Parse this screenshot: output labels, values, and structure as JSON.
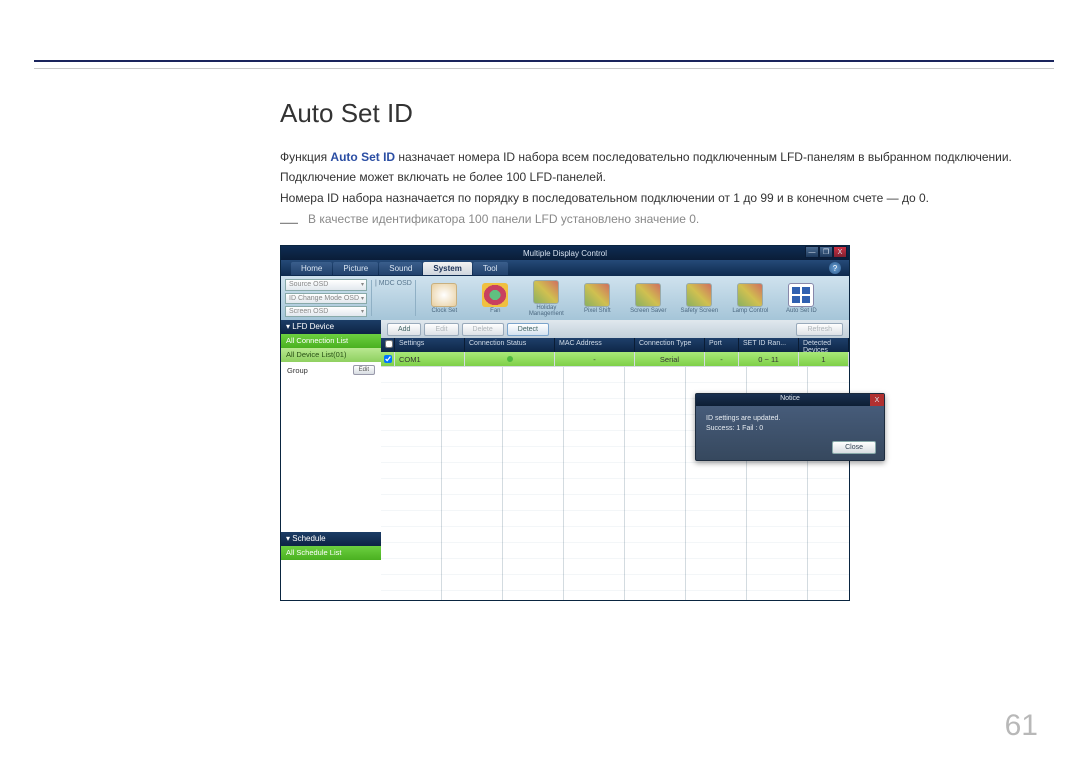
{
  "heading": "Auto Set ID",
  "p1_a": "Функция ",
  "p1_b": "Auto Set ID",
  "p1_c": " назначает номера ID набора всем последовательно подключенным LFD-панелям в выбранном подключении.",
  "p2": "Подключение может включать не более 100 LFD-панелей.",
  "p3": "Номера ID набора назначается по порядку в последовательном подключении от 1 до 99 и в конечном счете — до 0.",
  "note": "В качестве идентификатора 100 панели LFD установлено значение 0.",
  "page_number": "61",
  "app": {
    "title": "Multiple Display Control",
    "min": "—",
    "max": "❐",
    "close": "X",
    "tabs": {
      "home": "Home",
      "picture": "Picture",
      "sound": "Sound",
      "system": "System",
      "tool": "Tool"
    },
    "help": "?",
    "dd1": "Source OSD",
    "dd2": "ID Change Mode OSD",
    "dd3": "Screen OSD",
    "dd_sep": "| MDC OSD",
    "ricons": {
      "clock": "Clock Set",
      "fan": "Fan",
      "holiday": "Holiday\nManagement",
      "pixel": "Pixel Shift",
      "screen": "Screen Saver",
      "safety": "Safety\nScreen",
      "lamp": "Lamp Control",
      "autoid": "Auto Set ID"
    },
    "sidebar": {
      "h1": "▾  LFD Device",
      "g1": "All Connection List",
      "g2": "All Device List(01)",
      "row": "Group",
      "edit": "Edit",
      "h2": "▾  Schedule",
      "g3": "All Schedule List"
    },
    "tbar": {
      "add": "Add",
      "edit": "Edit",
      "delete": "Delete",
      "detect": "Detect",
      "refresh": "Refresh"
    },
    "thead": {
      "set": "Settings",
      "cs": "Connection Status",
      "mac": "MAC Address",
      "ct": "Connection Type",
      "pt": "Port",
      "sid": "SET ID Ran...",
      "dd": "Detected Devices"
    },
    "row": {
      "name": "COM1",
      "cs": "",
      "mac": "-",
      "ct": "Serial",
      "pt": "-",
      "sid": "0 ~ 11",
      "dd": "1"
    },
    "dialog": {
      "title": "Notice",
      "line1": "ID settings are updated.",
      "line2": "Success: 1  Fail : 0",
      "close": "Close"
    }
  }
}
